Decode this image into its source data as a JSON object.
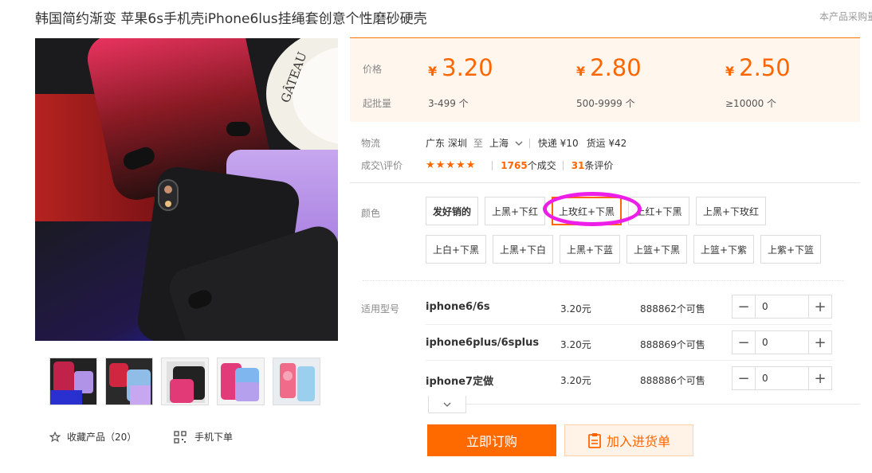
{
  "product": {
    "title": "韩国简约渐变 苹果6s手机壳iPhone6lus挂绳套创意个性磨砂硬壳",
    "top_note": "本产品采购量"
  },
  "gallery": {
    "thumbnails": [
      "thumb-1",
      "thumb-2",
      "thumb-3",
      "thumb-4",
      "thumb-5"
    ],
    "favorite_label": "收藏产品（20）",
    "mobile_order_label": "手机下单"
  },
  "price_box": {
    "price_label": "价格",
    "moq_label": "起批量",
    "tiers": [
      {
        "currency": "¥",
        "price": "3.20",
        "range": "3-499 个"
      },
      {
        "currency": "¥",
        "price": "2.80",
        "range": "500-9999 个"
      },
      {
        "currency": "¥",
        "price": "2.50",
        "range": "≥10000 个"
      }
    ],
    "accent_color": "#ff6600"
  },
  "logistics": {
    "label": "物流",
    "from": "广东 深圳",
    "to_word": "至",
    "to": "上海",
    "express": "快递 ¥10",
    "freight": "货运 ¥42"
  },
  "trade": {
    "label": "成交\\评价",
    "stars": "★★★★★",
    "deals_count": "1765",
    "deals_suffix": "个成交",
    "reviews_count": "31",
    "reviews_suffix": "条评价"
  },
  "color": {
    "label": "颜色",
    "options": [
      "发好销的",
      "上黑+下红",
      "上玫红+下黑",
      "上红+下黑",
      "上黑+下玫红",
      "上白+下黑",
      "上黑+下白",
      "上黑+下蓝",
      "上篮+下黑",
      "上篮+下紫",
      "上紫+下篮"
    ],
    "selected": "上玫红+下黑",
    "annotation_color": "#ee1ee9"
  },
  "models": {
    "label": "适用型号",
    "rows": [
      {
        "name": "iphone6/6s",
        "price": "3.20元",
        "stock": "888862个可售",
        "qty": "0"
      },
      {
        "name": "iphone6plus/6splus",
        "price": "3.20元",
        "stock": "888869个可售",
        "qty": "0"
      },
      {
        "name": "iphone7定做",
        "price": "3.20元",
        "stock": "888886个可售",
        "qty": "0"
      }
    ],
    "minus": "−",
    "plus": "+"
  },
  "actions": {
    "buy_now": "立即订购",
    "add_to_cart": "加入进货单"
  }
}
